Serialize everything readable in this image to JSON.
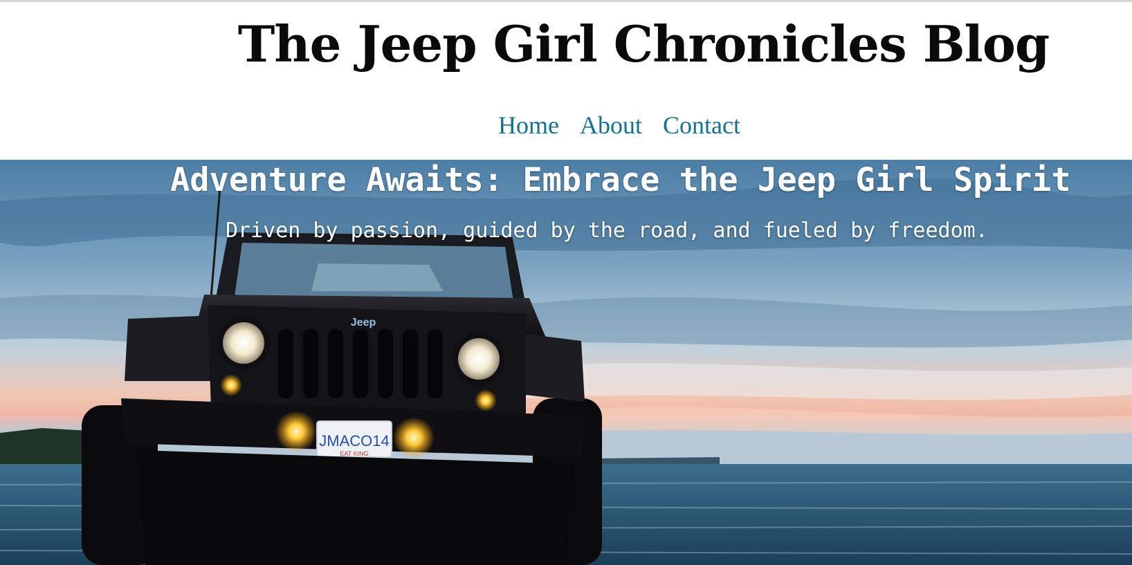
{
  "site": {
    "title": "The Jeep Girl Chronicles Blog"
  },
  "nav": {
    "items": [
      {
        "label": "Home"
      },
      {
        "label": "About"
      },
      {
        "label": "Contact"
      }
    ]
  },
  "hero": {
    "title": "Adventure Awaits: Embrace the Jeep Girl Spirit",
    "subtitle": "Driven by passion, guided by the road, and fueled by freedom.",
    "image": {
      "badge_text": "Jeep",
      "plate_text": "JMACO14",
      "plate_subtext": "EAT KING"
    }
  },
  "colors": {
    "title_text": "#0a0a0a",
    "nav_link": "#15708c",
    "hero_text": "#ffffff"
  }
}
